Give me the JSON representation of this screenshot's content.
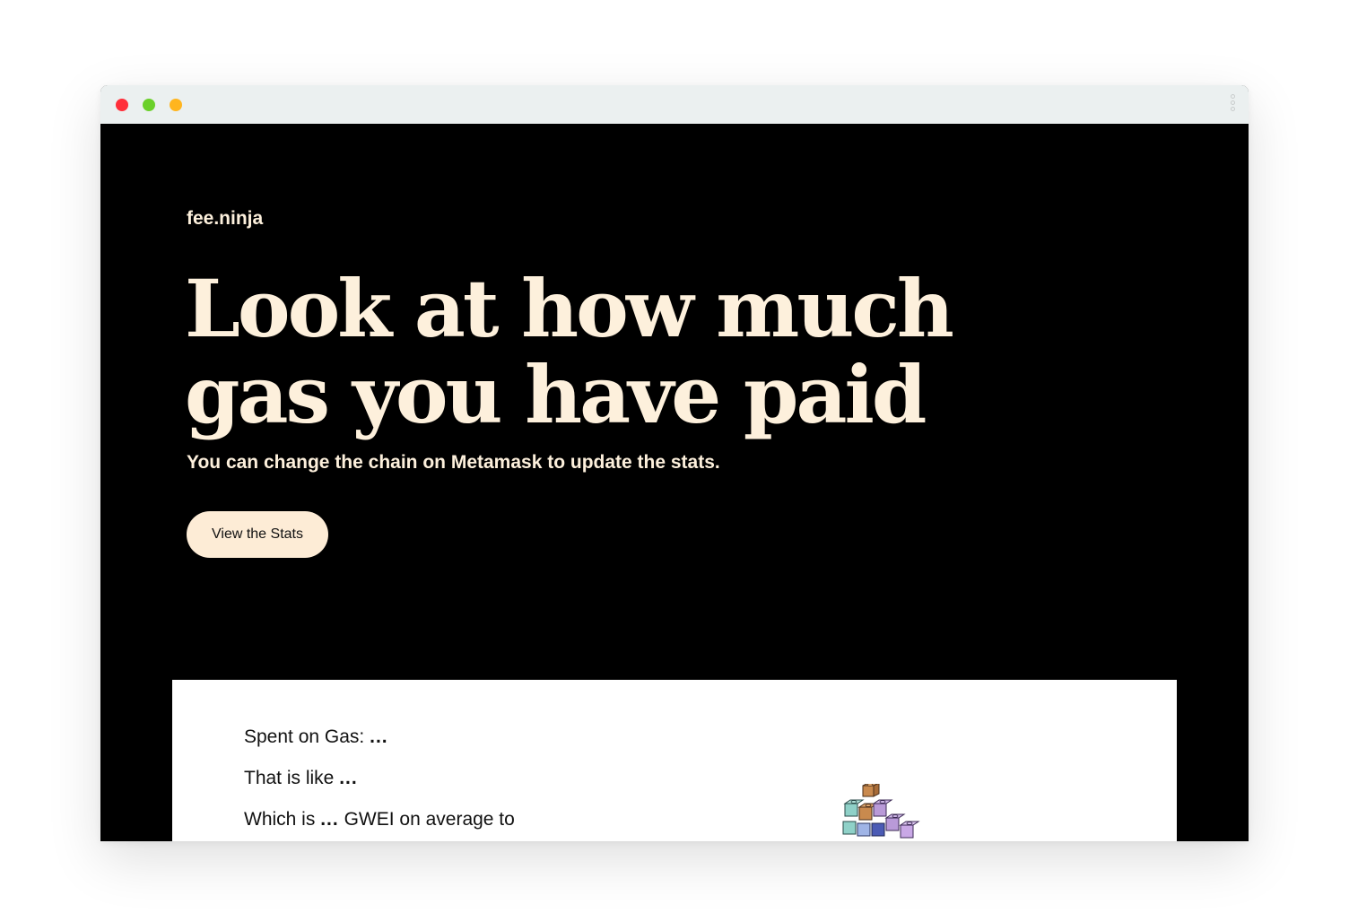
{
  "window": {
    "traffic_lights": {
      "close_color": "#ff2f3a",
      "minimize_color": "#6ad02a",
      "zoom_color": "#ffb51f"
    },
    "menu_icon": "kebab-vertical-icon"
  },
  "page": {
    "brand": "fee.ninja",
    "headline": "Look at how much gas you have paid",
    "subhead": "You can change the chain on Metamask to update the stats.",
    "cta_label": "View the Stats",
    "background_color": "#000000",
    "accent_color": "#fdf0dc"
  },
  "stats": {
    "spent_label": "Spent on Gas:",
    "spent_value": "...",
    "like_label": "That is like",
    "like_value": "...",
    "which_label": "Which is",
    "which_value": "...",
    "which_suffix": "GWEI on average to"
  },
  "illustration": {
    "icon": "stacked-blocks-icon"
  }
}
